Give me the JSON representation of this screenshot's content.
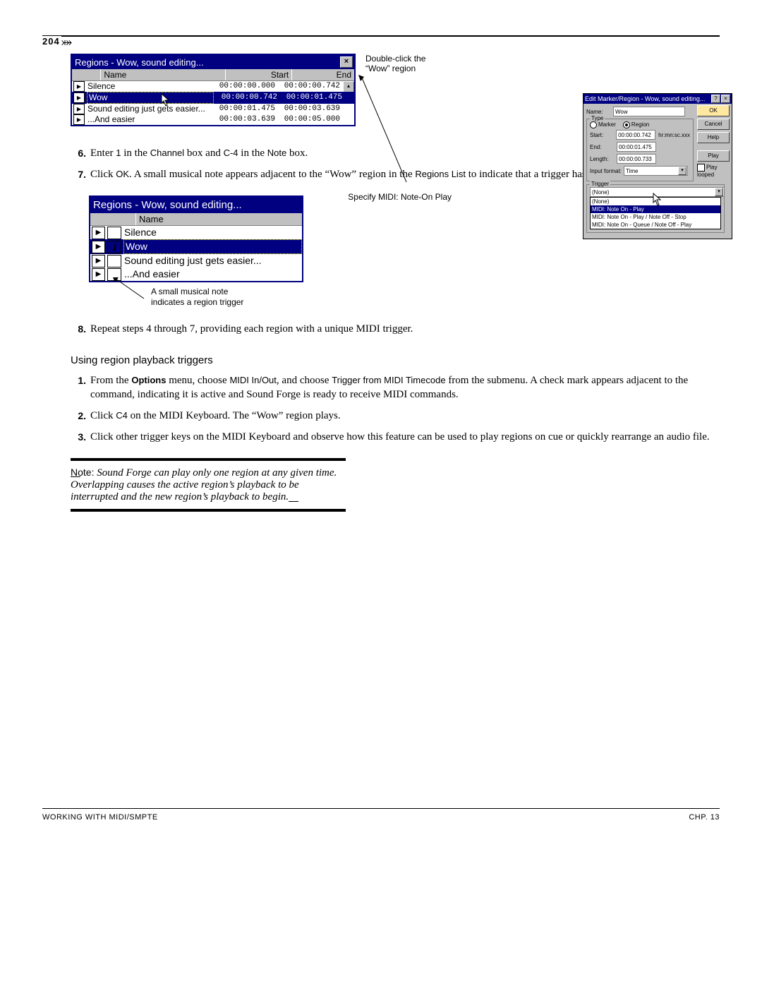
{
  "page_number": "204",
  "figure1": {
    "regions_window": {
      "title": "Regions - Wow, sound editing...",
      "columns": {
        "name": "Name",
        "start": "Start",
        "end": "End"
      },
      "rows": [
        {
          "name": "Silence",
          "start": "00:00:00.000",
          "end": "00:00:00.742",
          "selected": false
        },
        {
          "name": "Wow",
          "start": "00:00:00.742",
          "end": "00:00:01.475",
          "selected": true
        },
        {
          "name": "Sound editing just gets easier...",
          "start": "00:00:01.475",
          "end": "00:00:03.639",
          "selected": false
        },
        {
          "name": "...And easier",
          "start": "00:00:03.639",
          "end": "00:00:05.000",
          "selected": false
        }
      ]
    },
    "callout_top": "Double-click the\n“Wow” region",
    "callout_bottom": "Specify MIDI: Note-On Play",
    "edit_dialog": {
      "title": "Edit Marker/Region - Wow, sound editing...",
      "name_label": "Name:",
      "name_value": "Wow",
      "type_label": "Type",
      "type_marker": "Marker",
      "type_region": "Region",
      "start_label": "Start:",
      "start_value": "00:00:00.742",
      "start_unit": "hr:mn:sc.xxx",
      "end_label": "End:",
      "end_value": "00:00:01.475",
      "length_label": "Length:",
      "length_value": "00:00:00.733",
      "input_format_label": "Input format:",
      "input_format_value": "Time",
      "trigger_label": "Trigger",
      "trigger_value": "(None)",
      "trigger_options": [
        "(None)",
        "MIDI: Note On - Play",
        "MIDI: Note On - Play / Note Off - Stop",
        "MIDI: Note On - Queue / Note Off - Play"
      ],
      "buttons": {
        "ok": "OK",
        "cancel": "Cancel",
        "help": "Help",
        "play": "Play"
      },
      "play_looped_label": "Play looped"
    }
  },
  "steps_a": [
    {
      "n": "6.",
      "html": "Enter <sans>1</sans> in the <sans>Channel</sans> box and <sans>C-4</sans> in the <sans>Note</sans> box."
    },
    {
      "n": "7.",
      "html": "Click <sans>OK</sans>. A small musical note appears adjacent to the “Wow” region in the <sans>Regions List</sans> to indicate that a trigger has been configured."
    }
  ],
  "figure2": {
    "regions_window": {
      "title": "Regions - Wow, sound editing...",
      "column_name": "Name",
      "rows": [
        {
          "name": "Silence",
          "has_note": false,
          "selected": false
        },
        {
          "name": "Wow",
          "has_note": true,
          "selected": true
        },
        {
          "name": "Sound editing just gets easier...",
          "has_note": false,
          "selected": false
        },
        {
          "name": "...And easier",
          "has_note": false,
          "selected": false
        }
      ]
    },
    "caption": "A small musical note\nindicates a region trigger"
  },
  "steps_b": [
    {
      "n": "8.",
      "html": "Repeat steps 4 through 7, providing each region with a unique MIDI trigger."
    }
  ],
  "heading_b": "Using region playback triggers",
  "steps_c": [
    {
      "n": "1.",
      "html": "From the <b>Options</b> menu, choose <sans>MIDI In/Out</sans>, and choose <sans>Trigger from MIDI Timecode</sans> from the submenu. A check mark appears adjacent to the command, indicating it is active and Sound Forge is ready to receive MIDI commands."
    },
    {
      "n": "2.",
      "html": "Click <sans>C4</sans> on the MIDI Keyboard. The “Wow” region plays."
    },
    {
      "n": "3.",
      "html": "Click other trigger keys on the MIDI Keyboard and observe how this feature can be used to play regions on cue or quickly rearrange an audio file."
    }
  ],
  "note": {
    "label": "Note:",
    "body": "Sound Forge can play only one region at any given time. Overlapping causes the active region’s playback to be interrupted and the new region’s playback to begin."
  },
  "footer": {
    "left": "WORKING WITH MIDI/SMPTE",
    "right": "CHP. 13"
  }
}
